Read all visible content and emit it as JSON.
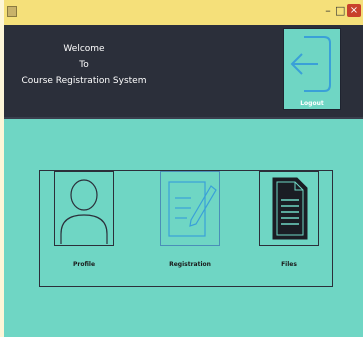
{
  "window": {
    "minimize_glyph": "–",
    "maximize_glyph": "□",
    "close_glyph": "×"
  },
  "header": {
    "welcome_line1": "Welcome",
    "welcome_line2": "To",
    "welcome_line3": "Course Registration System",
    "logout_label": "Logout",
    "logout_icon": "logout-arrow-icon"
  },
  "tiles": [
    {
      "label": "Profile",
      "icon": "user-icon"
    },
    {
      "label": "Registration",
      "icon": "edit-document-icon"
    },
    {
      "label": "Files",
      "icon": "file-icon"
    }
  ],
  "colors": {
    "background": "#6fd6c4",
    "header": "#2b2f3a",
    "titlebar": "#f5e07a",
    "accent_blue": "#3aa0d8"
  }
}
